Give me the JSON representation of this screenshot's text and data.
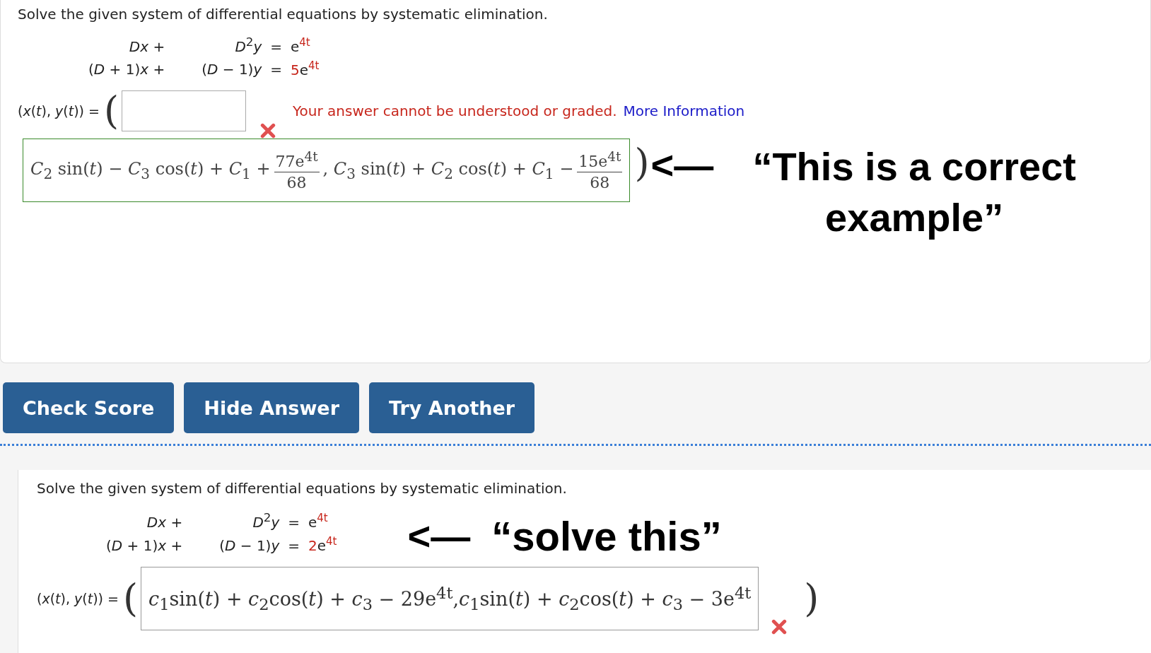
{
  "problems": [
    {
      "prompt": "Solve the given system of differential equations by systematic elimination.",
      "equations": [
        {
          "term_x": "*Dx* +",
          "term_y": "*D*$^{2}$*y*",
          "equals": "=",
          "rhs": {
            "base": "e",
            "exponent": "4t"
          }
        },
        {
          "term_x": "(*D* + 1)*x* +",
          "term_y": "(*D* − 1)*y*",
          "equals": "=",
          "rhs": {
            "coefficient": "5",
            "base": "e",
            "exponent": "4t"
          }
        }
      ],
      "answer": {
        "label": "(*x*(*t*), *y*(*t*)) =",
        "open_paren": "(",
        "close_paren": ")",
        "correct": false,
        "message": "Your answer cannot be understood or graded.",
        "link": "More Information",
        "correct_answer": [
          {
            "kind": "text",
            "text": "*C*$_{2}$ sin(*t*) − *C*$_{3}$ cos(*t*) + *C*$_{1}$ +"
          },
          {
            "kind": "fraction",
            "numerator": "77e$^{4t}$",
            "denominator": "68"
          },
          {
            "kind": "text",
            "text": ", *C*$_{3}$ sin(*t*) + *C*$_{2}$ cos(*t*) + *C*$_{1}$ −"
          },
          {
            "kind": "fraction",
            "numerator": "15e$^{4t}$",
            "denominator": "68"
          }
        ]
      },
      "annotation": {
        "arrow": "<—",
        "text": "“This is a correct example”"
      },
      "buttons": [
        "Check Score",
        "Hide Answer",
        "Try Another"
      ]
    },
    {
      "prompt": "Solve the given system of differential equations by systematic elimination.",
      "equations": [
        {
          "term_x": "*Dx* +",
          "term_y": "*D*$^{2}$*y*",
          "equals": "=",
          "rhs": {
            "base": "e",
            "exponent": "4t"
          }
        },
        {
          "term_x": "(*D* + 1)*x* +",
          "term_y": "(*D* − 1)*y*",
          "equals": "=",
          "rhs": {
            "coefficient": "2",
            "base": "e",
            "exponent": "4t"
          }
        }
      ],
      "annotation": {
        "arrow": "<—",
        "text": "“solve this”"
      },
      "answer": {
        "label": "(*x*(*t*), *y*(*t*)) =",
        "open_paren": "(",
        "close_paren": ")",
        "correct": false,
        "value": "*c*$_{1}$sin(*t*) + *c*$_{2}$cos(*t*) + *c*$_{3}$ − 29e$^{4t}$,*c*$_{1}$sin(*t*) + *c*$_{2}$cos(*t*) + *c*$_{3}$ − 3e$^{4t}$"
      }
    }
  ]
}
